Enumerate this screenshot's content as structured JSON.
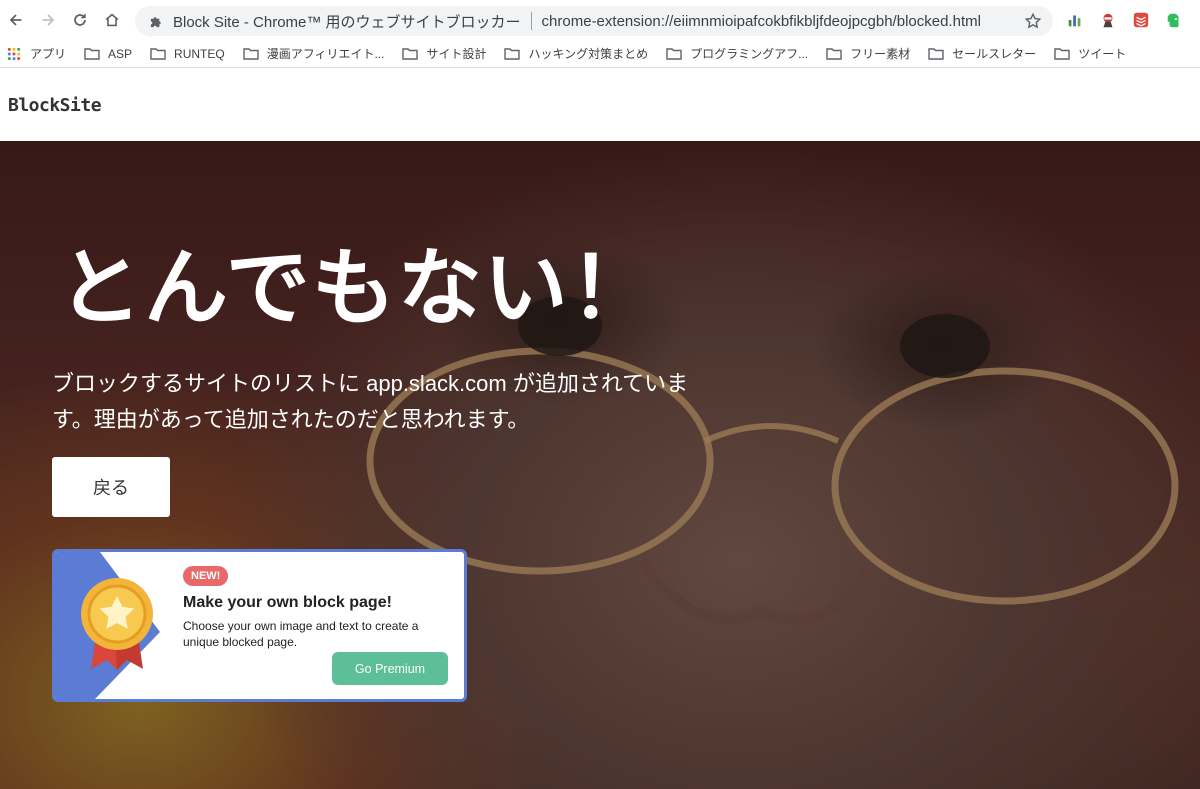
{
  "browser": {
    "tab_title": "Block Site - Chrome™ 用のウェブサイトブロッカー",
    "url": "chrome-extension://eiimnmioipafcokbfikbljfdeojpcgbh/blocked.html"
  },
  "bookmarks": [
    {
      "label": "アプリ",
      "icon": "apps-grid-icon"
    },
    {
      "label": "ASP",
      "icon": "folder-icon"
    },
    {
      "label": "RUNTEQ",
      "icon": "folder-icon"
    },
    {
      "label": "漫画アフィリエイト...",
      "icon": "folder-icon"
    },
    {
      "label": "サイト設計",
      "icon": "folder-icon"
    },
    {
      "label": "ハッキング対策まとめ",
      "icon": "folder-icon"
    },
    {
      "label": "プログラミングアフ...",
      "icon": "folder-icon"
    },
    {
      "label": "フリー素材",
      "icon": "folder-icon"
    },
    {
      "label": "セールスレター",
      "icon": "folder-icon"
    },
    {
      "label": "ツイート",
      "icon": "folder-icon"
    }
  ],
  "site": {
    "logo": "BlockSite"
  },
  "hero": {
    "headline": "とんでもない！",
    "message": "ブロックするサイトのリストに app.slack.com が追加されています。理由があって追加されたのだと思われます。",
    "back_label": "戻る"
  },
  "promo": {
    "badge": "NEW!",
    "title": "Make your own block page!",
    "description": "Choose your own image and text to create a unique blocked page.",
    "button_label": "Go Premium"
  },
  "colors": {
    "promo_border": "#5b7bd5",
    "badge": "#e8696a",
    "premium_button": "#5cbf97"
  }
}
